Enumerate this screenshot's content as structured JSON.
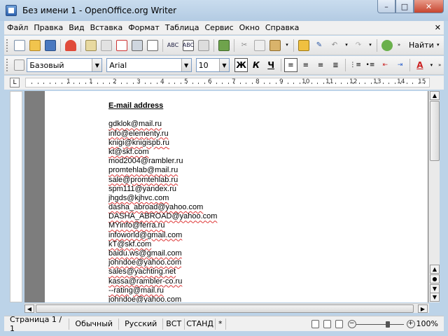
{
  "window": {
    "title": "Без имени 1 - OpenOffice.org Writer",
    "controls": {
      "minimize": "–",
      "maximize": "□",
      "close": "✕"
    }
  },
  "menu": {
    "items": [
      "Файл",
      "Правка",
      "Вид",
      "Вставка",
      "Формат",
      "Таблица",
      "Сервис",
      "Окно",
      "Справка"
    ],
    "close_doc": "✕"
  },
  "toolbar_standard": {
    "find_label": "Найти"
  },
  "toolbar_format": {
    "style": "Базовый",
    "font": "Arial",
    "size": "10",
    "bold": "Ж",
    "italic": "К",
    "underline": "Ч"
  },
  "ruler": {
    "labels": [
      "1",
      "1",
      "2",
      "3",
      "4",
      "5",
      "6",
      "7",
      "8",
      "9",
      "10",
      "11",
      "12",
      "13",
      "14",
      "15",
      "16"
    ]
  },
  "document": {
    "heading": "E-mail address",
    "emails": [
      {
        "text": "gdklok@mail.ru",
        "spell": true
      },
      {
        "text": "info@elementy.ru",
        "spell": true
      },
      {
        "text": "knigi@knigispb.ru",
        "spell": true
      },
      {
        "text": "kt@skf.com",
        "spell": true
      },
      {
        "text": "mod2004@rambler.ru",
        "spell": false
      },
      {
        "text": "promtehlab@mail.ru",
        "spell": true
      },
      {
        "text": "sale@promtehlab.ru",
        "spell": true
      },
      {
        "text": "spm111@yandex.ru",
        "spell": false
      },
      {
        "text": "jhgds@kjhvc.com",
        "spell": true
      },
      {
        "text": "dasha_abroad@yahoo.com",
        "spell": true
      },
      {
        "text": "DASHA_ABROAD@yahoo.com",
        "spell": true
      },
      {
        "text": "MYinfo@ferra.ru",
        "spell": true
      },
      {
        "text": "infoworld@gmail.com",
        "spell": true
      },
      {
        "text": "kT@skf.com",
        "spell": true
      },
      {
        "text": "baidu.ws@gmail.com",
        "spell": true
      },
      {
        "text": "johndoe@yahoo.com",
        "spell": true
      },
      {
        "text": "sales@yachting.net",
        "spell": true
      },
      {
        "text": "kassa@rambler-co.ru",
        "spell": true
      },
      {
        "text": "--rating@mail.ru",
        "spell": true
      },
      {
        "text": "johndoe@yahoo.com",
        "spell": false
      }
    ]
  },
  "statusbar": {
    "page": "Страница 1 / 1",
    "style": "Обычный",
    "language": "Русский",
    "insert_mode": "ВСТ",
    "selection_mode": "СТАНД",
    "modified": "*",
    "zoom": "100%"
  },
  "colors": {
    "spell_underline": "#d33",
    "titlebar": "#c9dcee",
    "close_button": "#c7452f"
  }
}
